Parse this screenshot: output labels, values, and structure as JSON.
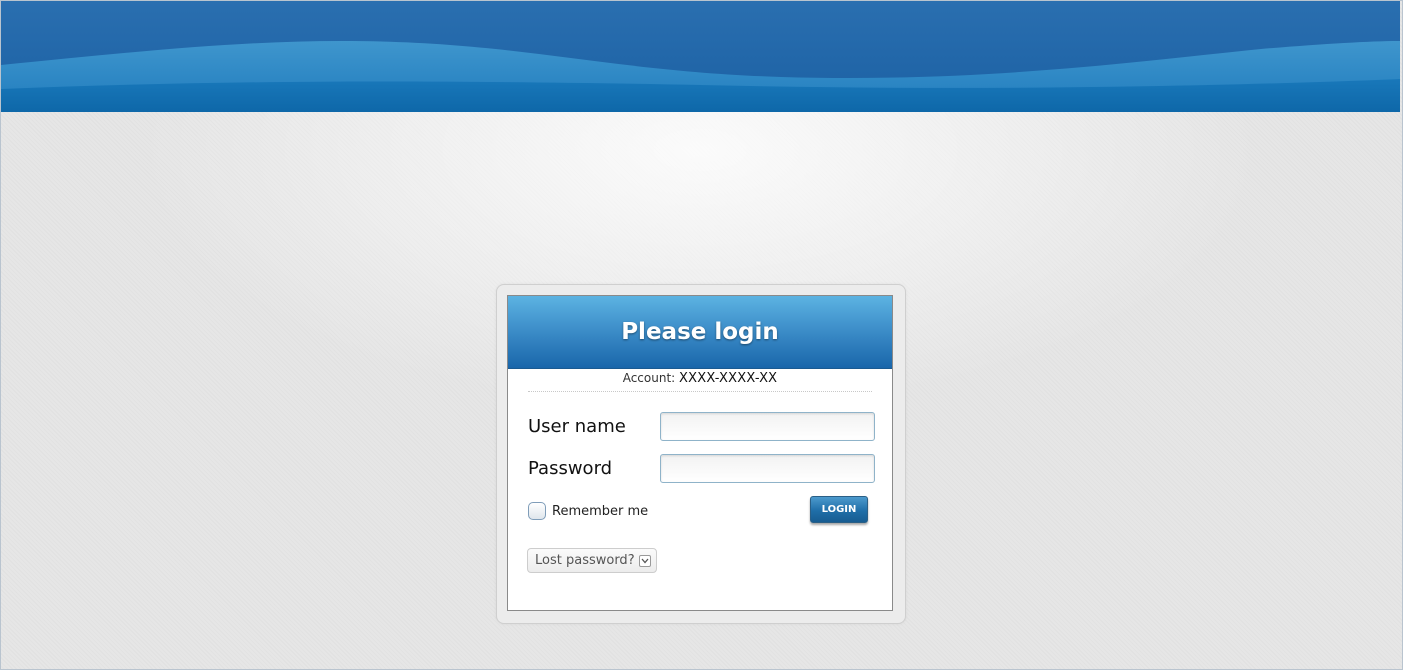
{
  "banner": {
    "colors": {
      "dark": "#1f68ab",
      "light": "#3a8cc6",
      "band": "#0d6aa9"
    }
  },
  "login": {
    "title": "Please login",
    "account_label": "Account:",
    "account_value": "XXXX-XXXX-XX",
    "username_label": "User name",
    "username_value": "",
    "password_label": "Password",
    "password_value": "",
    "remember_label": "Remember me",
    "remember_checked": false,
    "login_button": "LOGIN",
    "lost_password_label": "Lost password?",
    "lost_password_icon": "chevron-down-icon",
    "accent_color": "#1f6ea8"
  }
}
